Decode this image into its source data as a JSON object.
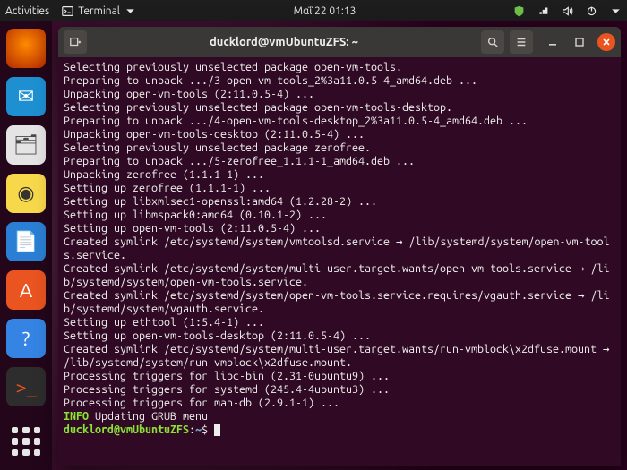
{
  "topbar": {
    "activities": "Activities",
    "app_label": "Terminal",
    "clock": "Μαΐ 22  01:13"
  },
  "dock": {
    "items": [
      {
        "name": "firefox",
        "glyph": ""
      },
      {
        "name": "thunderbird",
        "glyph": "✉"
      },
      {
        "name": "files",
        "glyph": "🗂"
      },
      {
        "name": "rhythmbox",
        "glyph": "◉"
      },
      {
        "name": "writer",
        "glyph": "📄"
      },
      {
        "name": "software",
        "glyph": "A"
      },
      {
        "name": "help",
        "glyph": "?"
      },
      {
        "name": "terminal",
        "glyph": ">_"
      }
    ]
  },
  "window": {
    "title": "ducklord@vmUbuntuZFS: ~"
  },
  "terminal": {
    "lines": [
      "Selecting previously unselected package open-vm-tools.",
      "Preparing to unpack .../3-open-vm-tools_2%3a11.0.5-4_amd64.deb ...",
      "Unpacking open-vm-tools (2:11.0.5-4) ...",
      "Selecting previously unselected package open-vm-tools-desktop.",
      "Preparing to unpack .../4-open-vm-tools-desktop_2%3a11.0.5-4_amd64.deb ...",
      "Unpacking open-vm-tools-desktop (2:11.0.5-4) ...",
      "Selecting previously unselected package zerofree.",
      "Preparing to unpack .../5-zerofree_1.1.1-1_amd64.deb ...",
      "Unpacking zerofree (1.1.1-1) ...",
      "Setting up zerofree (1.1.1-1) ...",
      "Setting up libxmlsec1-openssl:amd64 (1.2.28-2) ...",
      "Setting up libmspack0:amd64 (0.10.1-2) ...",
      "Setting up open-vm-tools (2:11.0.5-4) ...",
      "Created symlink /etc/systemd/system/vmtoolsd.service → /lib/systemd/system/open-vm-tools.service.",
      "Created symlink /etc/systemd/system/multi-user.target.wants/open-vm-tools.service → /lib/systemd/system/open-vm-tools.service.",
      "Created symlink /etc/systemd/system/open-vm-tools.service.requires/vgauth.service → /lib/systemd/system/vgauth.service.",
      "Setting up ethtool (1:5.4-1) ...",
      "Setting up open-vm-tools-desktop (2:11.0.5-4) ...",
      "Created symlink /etc/systemd/system/multi-user.target.wants/run-vmblock\\x2dfuse.mount → /lib/systemd/system/run-vmblock\\x2dfuse.mount.",
      "Processing triggers for libc-bin (2.31-0ubuntu9) ...",
      "Processing triggers for systemd (245.4-4ubuntu3) ...",
      "Processing triggers for man-db (2.9.1-1) ..."
    ],
    "info_prefix": "INFO",
    "info_text": " Updating GRUB menu",
    "prompt": {
      "user": "ducklord",
      "at": "@",
      "host": "vmUbuntuZFS",
      "colon": ":",
      "path": "~",
      "dollar": "$"
    }
  }
}
